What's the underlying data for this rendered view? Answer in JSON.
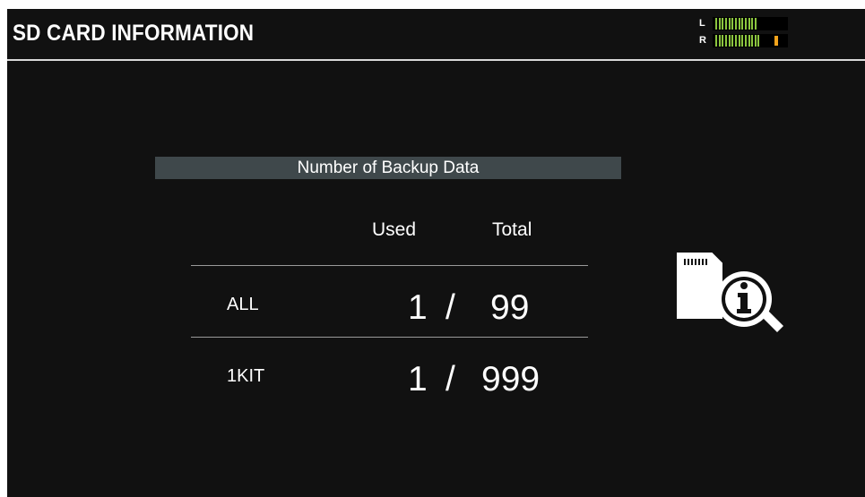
{
  "screen": {
    "title": "SD CARD INFORMATION"
  },
  "meter": {
    "left_label": "L",
    "right_label": "R",
    "left_level": 0.58,
    "right_level": 0.62,
    "right_peak_level": 0.82,
    "level_color": "#8cc63f",
    "peak_color": "#f4a41c"
  },
  "backup_info": {
    "section_title": "Number of Backup Data",
    "columns": {
      "used": "Used",
      "total": "Total"
    },
    "rows": [
      {
        "label": "ALL",
        "used": "1",
        "separator": "/",
        "total": "99"
      },
      {
        "label": "1KIT",
        "used": "1",
        "separator": "/",
        "total": "999"
      }
    ]
  },
  "icons": {
    "sd_card_info": "sd-card-info-icon"
  },
  "colors": {
    "background": "#111111",
    "section_bar": "#3f484b",
    "text": "#ffffff"
  }
}
